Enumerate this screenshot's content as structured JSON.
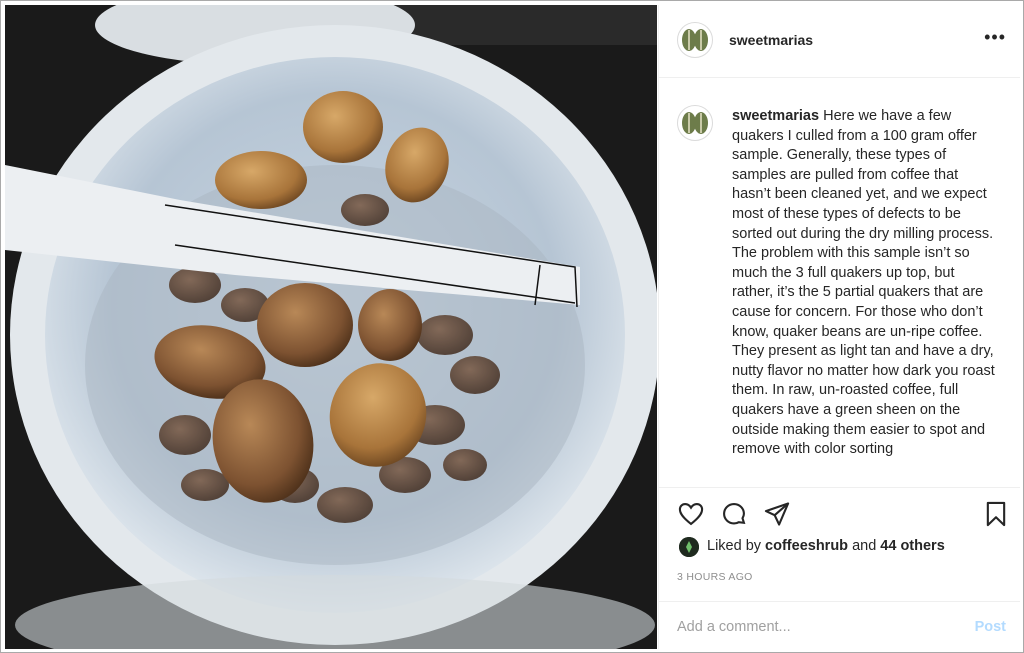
{
  "post": {
    "username": "sweetmarias",
    "caption_user": "sweetmarias",
    "caption": "Here we have a few quakers I culled from a 100 gram offer sample. Generally, these types of samples are pulled from coffee that hasn’t been cleaned yet, and we expect most of these types of defects to be sorted out during the dry milling process. The problem with this sample isn’t so much the 3 full quakers up top, but rather, it’s the 5 partial quakers that are cause for concern. For those who don’t know, quaker beans are un-ripe coffee. They present as light tan and have a dry, nutty flavor no matter how dark you roast them. In raw, un-roasted coffee, full quakers have a green sheen on the outside making them easier to spot and remove with color sorting",
    "more_label": "•••",
    "liked_prefix": "Liked by ",
    "liked_user": "coffeeshrub",
    "liked_and": " and ",
    "liked_others": "44 others",
    "timestamp": "3 HOURS AGO",
    "comment_placeholder": "Add a comment...",
    "post_label": "Post"
  },
  "icons": {
    "like": "heart-icon",
    "comment": "comment-icon",
    "share": "paper-plane-icon",
    "save": "bookmark-icon",
    "more": "more-options-icon"
  },
  "colors": {
    "text": "#262626",
    "muted": "#8e8e8e",
    "post_disabled": "#b3dbff",
    "divider": "#efefef"
  }
}
